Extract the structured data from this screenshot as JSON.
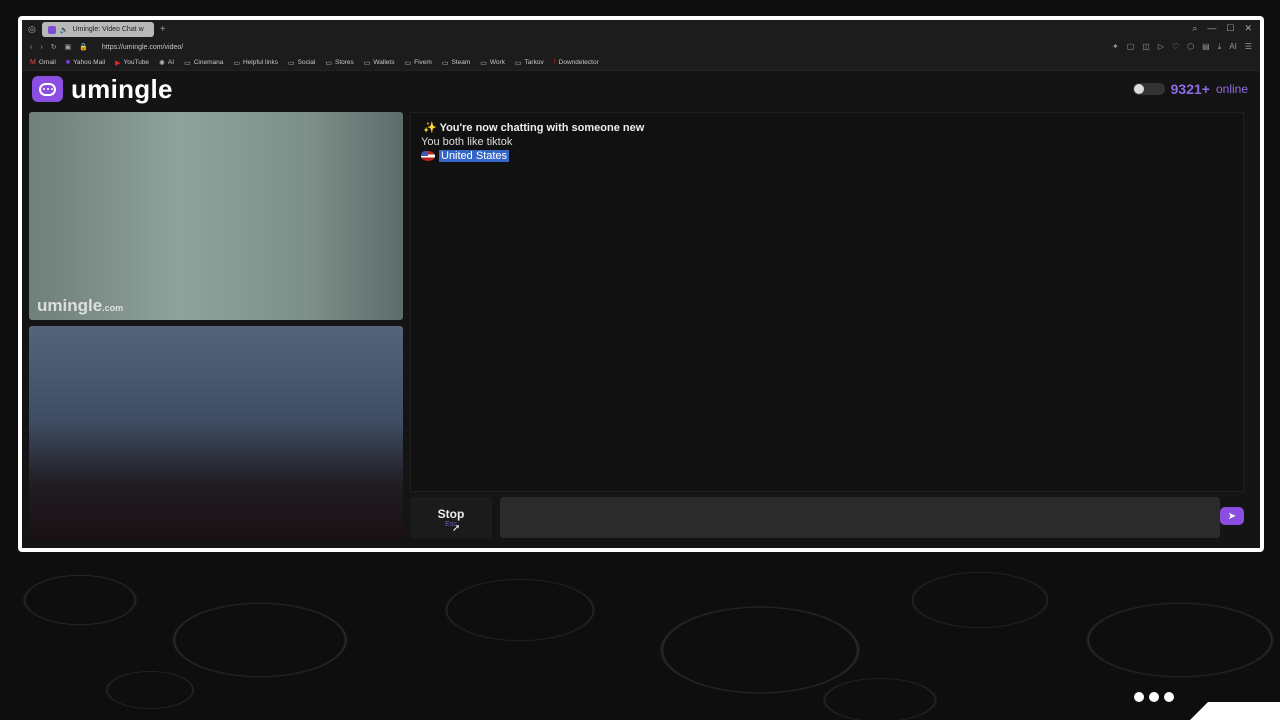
{
  "browser": {
    "tab_title": "Umingle: Video Chat w",
    "new_tab": "+",
    "url": "https://umingle.com/video/",
    "bookmarks": [
      {
        "label": "Gmail",
        "icon": "gmail-icon"
      },
      {
        "label": "Yahoo Mail",
        "icon": "yahoo-icon"
      },
      {
        "label": "YouTube",
        "icon": "youtube-icon"
      },
      {
        "label": "AI",
        "icon": "ai-icon"
      },
      {
        "label": "Cinemana",
        "icon": "folder-icon"
      },
      {
        "label": "Helpful links",
        "icon": "folder-icon"
      },
      {
        "label": "Social",
        "icon": "folder-icon"
      },
      {
        "label": "Stores",
        "icon": "folder-icon"
      },
      {
        "label": "Wallets",
        "icon": "folder-icon"
      },
      {
        "label": "Fivem",
        "icon": "folder-icon"
      },
      {
        "label": "Steam",
        "icon": "folder-icon"
      },
      {
        "label": "Work",
        "icon": "folder-icon"
      },
      {
        "label": "Tarkov",
        "icon": "folder-icon"
      },
      {
        "label": "Downdetector",
        "icon": "downdetector-icon"
      }
    ]
  },
  "site": {
    "brand": "umingle",
    "online_count": "9321+",
    "online_label": "online",
    "accent": "#8a4fe0"
  },
  "video": {
    "watermark": "umingle",
    "watermark_suffix": ".com"
  },
  "chat": {
    "message_1": "You're now chatting with someone new",
    "message_2": "You both like tiktok",
    "country": "United States"
  },
  "controls": {
    "stop_label": "Stop",
    "stop_hint": "Esc",
    "input_value": ""
  }
}
